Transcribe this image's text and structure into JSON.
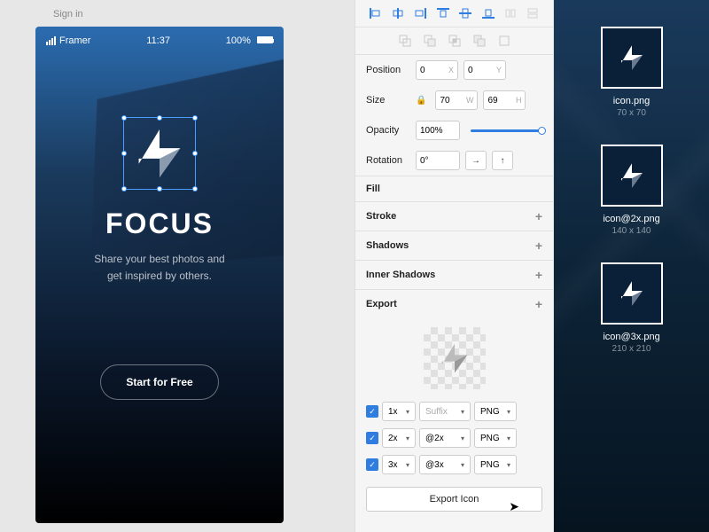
{
  "left": {
    "sign_in": "Sign in",
    "carrier": "Framer",
    "time": "11:37",
    "battery": "100%",
    "app_title": "FOCUS",
    "subtitle_line1": "Share your best photos and",
    "subtitle_line2": "get inspired by others.",
    "cta": "Start for Free"
  },
  "inspector": {
    "position": {
      "label": "Position",
      "x": "0",
      "y": "0"
    },
    "size": {
      "label": "Size",
      "w": "70",
      "h": "69"
    },
    "opacity": {
      "label": "Opacity",
      "value": "100%"
    },
    "rotation": {
      "label": "Rotation",
      "value": "0°"
    },
    "sections": {
      "fill": "Fill",
      "stroke": "Stroke",
      "shadows": "Shadows",
      "inner_shadows": "Inner Shadows",
      "export": "Export"
    },
    "export_rows": [
      {
        "scale": "1x",
        "suffix": "Suffix",
        "format": "PNG"
      },
      {
        "scale": "2x",
        "suffix": "@2x",
        "format": "PNG"
      },
      {
        "scale": "3x",
        "suffix": "@3x",
        "format": "PNG"
      }
    ],
    "export_button": "Export Icon"
  },
  "previews": [
    {
      "name": "icon.png",
      "dims": "70 x 70"
    },
    {
      "name": "icon@2x.png",
      "dims": "140 x 140"
    },
    {
      "name": "icon@3x.png",
      "dims": "210 x 210"
    }
  ]
}
